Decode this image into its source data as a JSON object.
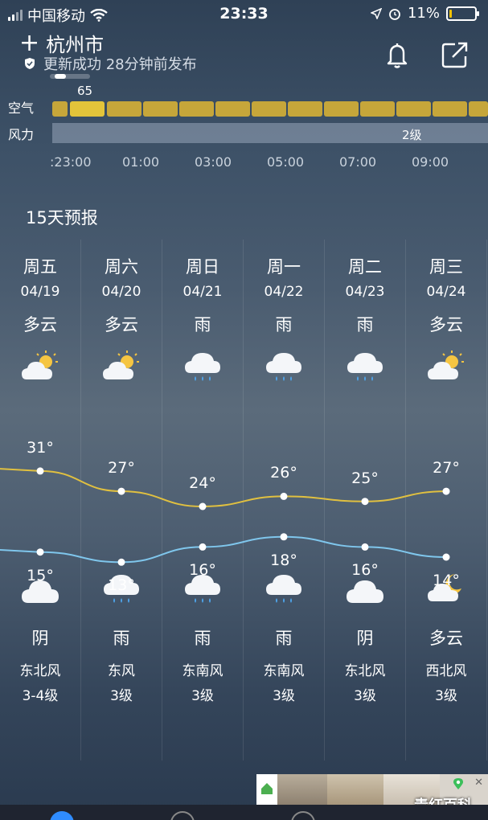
{
  "status": {
    "carrier": "中国移动",
    "time": "23:33",
    "battery": "11%",
    "battery_level": 0.11
  },
  "header": {
    "city": "杭州市",
    "update": "更新成功 28分钟前发布"
  },
  "hourly": {
    "aqi_label": "空气",
    "wind_label": "风力",
    "aqi_value": "65",
    "wind_value": "2级",
    "hours": [
      ":23:00",
      "01:00",
      "03:00",
      "05:00",
      "07:00",
      "09:00"
    ]
  },
  "forecast": {
    "title": "15天预报",
    "days": [
      {
        "weekday": "周五",
        "date": "04/19",
        "day_cond": "多云",
        "day_icon": "partly-cloudy-day-icon",
        "high": "31°",
        "low": "15°",
        "night_icon": "cloudy-icon",
        "night_cond": "阴",
        "wind_dir": "东北风",
        "wind_lvl": "3-4级"
      },
      {
        "weekday": "周六",
        "date": "04/20",
        "day_cond": "多云",
        "day_icon": "partly-cloudy-day-icon",
        "high": "27°",
        "low": "13°",
        "night_icon": "rain-icon",
        "night_cond": "雨",
        "wind_dir": "东风",
        "wind_lvl": "3级"
      },
      {
        "weekday": "周日",
        "date": "04/21",
        "day_cond": "雨",
        "day_icon": "rain-icon",
        "high": "24°",
        "low": "16°",
        "night_icon": "rain-icon",
        "night_cond": "雨",
        "wind_dir": "东南风",
        "wind_lvl": "3级"
      },
      {
        "weekday": "周一",
        "date": "04/22",
        "day_cond": "雨",
        "day_icon": "rain-icon",
        "high": "26°",
        "low": "18°",
        "night_icon": "rain-icon",
        "night_cond": "雨",
        "wind_dir": "东南风",
        "wind_lvl": "3级"
      },
      {
        "weekday": "周二",
        "date": "04/23",
        "day_cond": "雨",
        "day_icon": "rain-icon",
        "high": "25°",
        "low": "16°",
        "night_icon": "cloudy-icon",
        "night_cond": "阴",
        "wind_dir": "东北风",
        "wind_lvl": "3级"
      },
      {
        "weekday": "周三",
        "date": "04/24",
        "day_cond": "多云",
        "day_icon": "partly-cloudy-day-icon",
        "high": "27°",
        "low": "14°",
        "night_icon": "partly-cloudy-night-icon",
        "night_cond": "多云",
        "wind_dir": "西北风",
        "wind_lvl": "3级"
      }
    ]
  },
  "chart_data": {
    "type": "line",
    "categories": [
      "周五",
      "周六",
      "周日",
      "周一",
      "周二",
      "周三"
    ],
    "series": [
      {
        "values": [
          31,
          27,
          24,
          26,
          25,
          27
        ],
        "color": "#e0c040"
      },
      {
        "values": [
          15,
          13,
          16,
          18,
          16,
          14
        ],
        "color": "#7fc6ec"
      }
    ]
  },
  "watermark": "青红百科",
  "colors": {
    "aqi_bar": "#c6a63a",
    "aqi_active": "#e3c43a",
    "high_line": "#e0c040",
    "low_line": "#7fc6ec"
  }
}
